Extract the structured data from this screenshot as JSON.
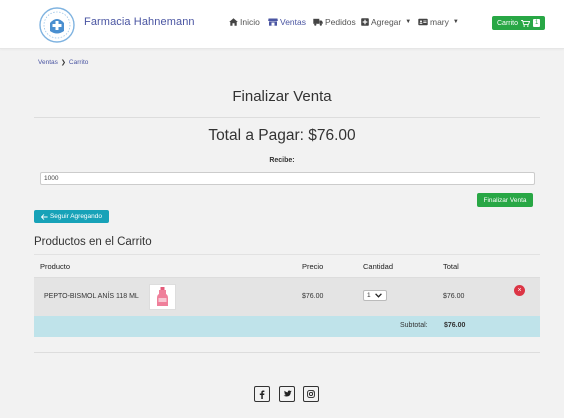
{
  "brand": {
    "name": "Farmacia Hahnemann"
  },
  "nav": {
    "inicio": "Inicio",
    "ventas": "Ventas",
    "pedidos": "Pedidos",
    "agregar": "Agregar",
    "user": "mary",
    "cart_label": "Carrito",
    "cart_count": "1"
  },
  "breadcrumb": {
    "parent": "Ventas",
    "current": "Carrito"
  },
  "page": {
    "title": "Finalizar Venta",
    "total_label": "Total a Pagar: $76.00",
    "recibe_label": "Recibe:",
    "recibe_value": "1000",
    "finalizar_button": "Finalizar Venta",
    "seguir_button": "Seguir Agregando",
    "cart_heading": "Productos en el Carrito"
  },
  "table": {
    "headers": [
      "Producto",
      "Precio",
      "Cantidad",
      "Total"
    ],
    "rows": [
      {
        "product": "PEPTO-BISMOL ANÍS 118 ML",
        "price": "$76.00",
        "quantity": "1",
        "total": "$76.00"
      }
    ],
    "subtotal_label": "Subtotal:",
    "subtotal_value": "$76.00"
  },
  "icons": {
    "home": "home-icon",
    "store": "store-icon",
    "truck": "truck-icon",
    "plus_box": "plus-box-icon",
    "id_card": "id-card-icon",
    "cart": "cart-icon",
    "close": "close-icon",
    "arrow_left": "arrow-left-icon",
    "facebook": "facebook-icon",
    "twitter": "twitter-icon",
    "instagram": "instagram-icon"
  },
  "colors": {
    "brand": "#4a55a2",
    "success": "#28a745",
    "info": "#17a2b8",
    "danger": "#dc3545",
    "row_highlight": "#e4e4e4",
    "subtotal_bg": "#bfe3ea"
  }
}
